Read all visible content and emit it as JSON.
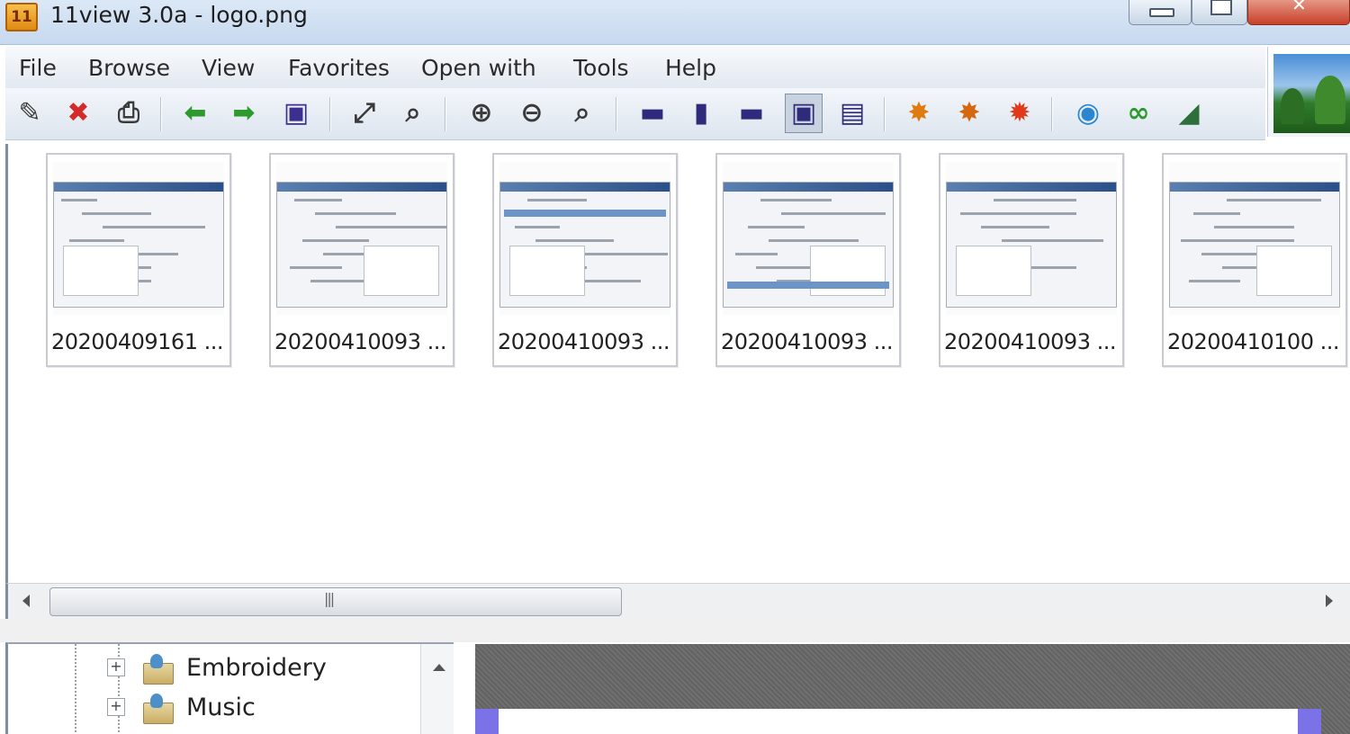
{
  "window": {
    "title": "11view 3.0a - logo.png",
    "app_icon_text": "11",
    "controls": [
      "minimize",
      "maximize",
      "close"
    ]
  },
  "menu": {
    "items": [
      "File",
      "Browse",
      "View",
      "Favorites",
      "Open with",
      "Tools",
      "Help"
    ]
  },
  "toolbar": {
    "buttons": [
      {
        "name": "edit-icon",
        "glyph": "✎",
        "color": "#3a3a3a"
      },
      {
        "name": "delete-icon",
        "glyph": "✖",
        "color": "#d42a2a"
      },
      {
        "name": "print-icon",
        "glyph": "⎙",
        "color": "#3a3a3a"
      },
      {
        "name": "back-arrow-icon",
        "glyph": "⬅",
        "color": "#2e9a2e"
      },
      {
        "name": "forward-arrow-icon",
        "glyph": "➡",
        "color": "#2e9a2e"
      },
      {
        "name": "slideshow-icon",
        "glyph": "▣",
        "color": "#3b2f8f"
      },
      {
        "name": "fullscreen-icon",
        "glyph": "⤢",
        "color": "#3a3a3a"
      },
      {
        "name": "zoom-fit-icon",
        "glyph": "⌕",
        "color": "#3a3a3a"
      },
      {
        "name": "zoom-in-icon",
        "glyph": "⊕",
        "color": "#3a3a3a"
      },
      {
        "name": "zoom-out-icon",
        "glyph": "⊖",
        "color": "#3a3a3a"
      },
      {
        "name": "zoom-actual-icon",
        "glyph": "⌕",
        "color": "#3a3a3a"
      },
      {
        "name": "view-small-icon",
        "glyph": "▬",
        "color": "#2f2a7c"
      },
      {
        "name": "view-tall-icon",
        "glyph": "▮",
        "color": "#2f2a7c"
      },
      {
        "name": "view-wide-icon",
        "glyph": "▬",
        "color": "#2f2a7c"
      },
      {
        "name": "view-thumbnails-icon",
        "glyph": "▣",
        "color": "#2f2a7c"
      },
      {
        "name": "view-film-icon",
        "glyph": "▤",
        "color": "#2f2a7c"
      },
      {
        "name": "brightness-up-icon",
        "glyph": "✸",
        "color": "#e07b10"
      },
      {
        "name": "brightness-down-icon",
        "glyph": "✸",
        "color": "#d5680e"
      },
      {
        "name": "contrast-icon",
        "glyph": "✹",
        "color": "#e03a1a"
      },
      {
        "name": "rotate-icon",
        "glyph": "◉",
        "color": "#2a86d0"
      },
      {
        "name": "link-icon",
        "glyph": "∞",
        "color": "#2e9a2e"
      },
      {
        "name": "landscape-image-icon",
        "glyph": "◢",
        "color": "#2d6e3a"
      }
    ]
  },
  "thumbnails": [
    {
      "label": "20200409161 ..."
    },
    {
      "label": "20200410093 ..."
    },
    {
      "label": "20200410093 ..."
    },
    {
      "label": "20200410093 ..."
    },
    {
      "label": "20200410093 ..."
    },
    {
      "label": "20200410100 ..."
    }
  ],
  "folder_tree": {
    "items": [
      {
        "label": "Embroidery",
        "expander": "+"
      },
      {
        "label": "Music",
        "expander": "+"
      }
    ]
  },
  "colors": {
    "title_bar": "#c7d9ef",
    "close_button": "#c7402a",
    "preview_background": "#6b6b6b",
    "preview_accent": "#7a72e6"
  }
}
